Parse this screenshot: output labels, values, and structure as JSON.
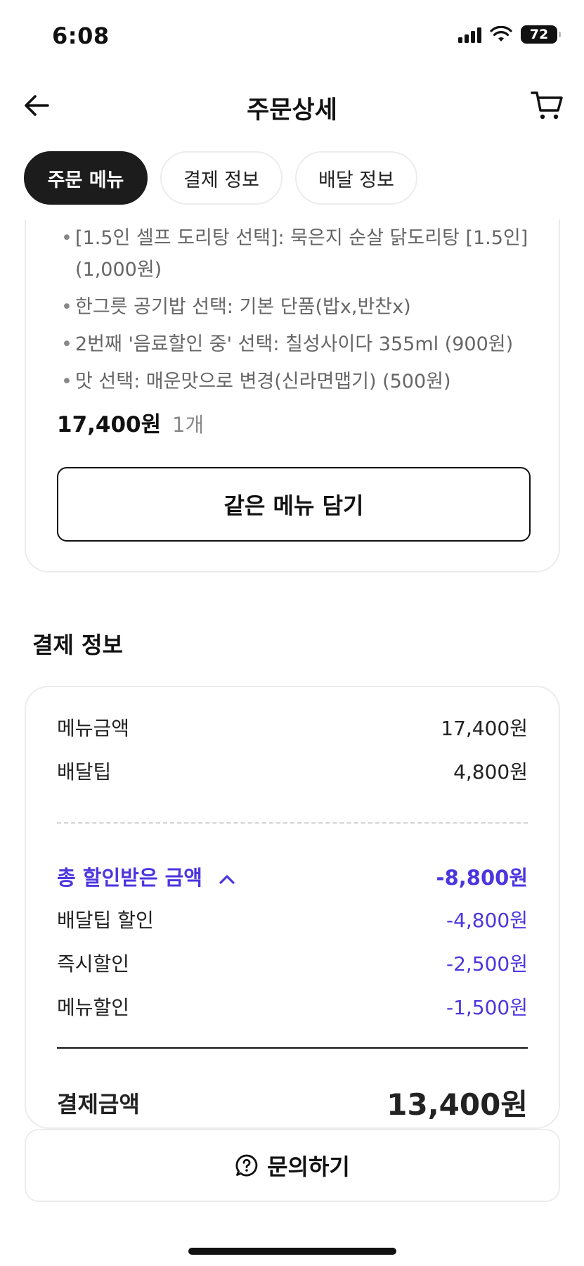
{
  "status_bar": {
    "time": "6:08",
    "battery": "72"
  },
  "header": {
    "title": "주문상세",
    "back_icon": "arrow-left-icon",
    "cart_icon": "cart-icon"
  },
  "tabs": [
    {
      "label": "주문 메뉴",
      "active": true
    },
    {
      "label": "결제 정보",
      "active": false
    },
    {
      "label": "배달 정보",
      "active": false
    }
  ],
  "order_menu": {
    "options": [
      "[1.5인 셀프 도리탕 선택]: 묵은지 순살 닭도리탕 [1.5인] (1,000원)",
      "한그릇 공기밥 선택: 기본 단품(밥x,반찬x)",
      "2번째 '음료할인 중' 선택: 칠성사이다 355ml (900원)",
      "맛 선택: 매운맛으로 변경(신라면맵기) (500원)"
    ],
    "price": "17,400원",
    "quantity": "1개",
    "same_menu_button": "같은 메뉴 담기"
  },
  "payment": {
    "section_title": "결제 정보",
    "menu_amount_label": "메뉴금액",
    "menu_amount_value": "17,400원",
    "delivery_tip_label": "배달팁",
    "delivery_tip_value": "4,800원",
    "total_discount_label": "총 할인받은 금액",
    "total_discount_value": "-8,800원",
    "discounts": [
      {
        "label": "배달팁 할인",
        "value": "-4,800원"
      },
      {
        "label": "즉시할인",
        "value": "-2,500원"
      },
      {
        "label": "메뉴할인",
        "value": "-1,500원"
      }
    ],
    "final_label": "결제금액",
    "final_value": "13,400원"
  },
  "inquiry_button": "문의하기",
  "colors": {
    "accent": "#4b36e0",
    "active_tab": "#1c1c1c",
    "border": "#ececec"
  }
}
